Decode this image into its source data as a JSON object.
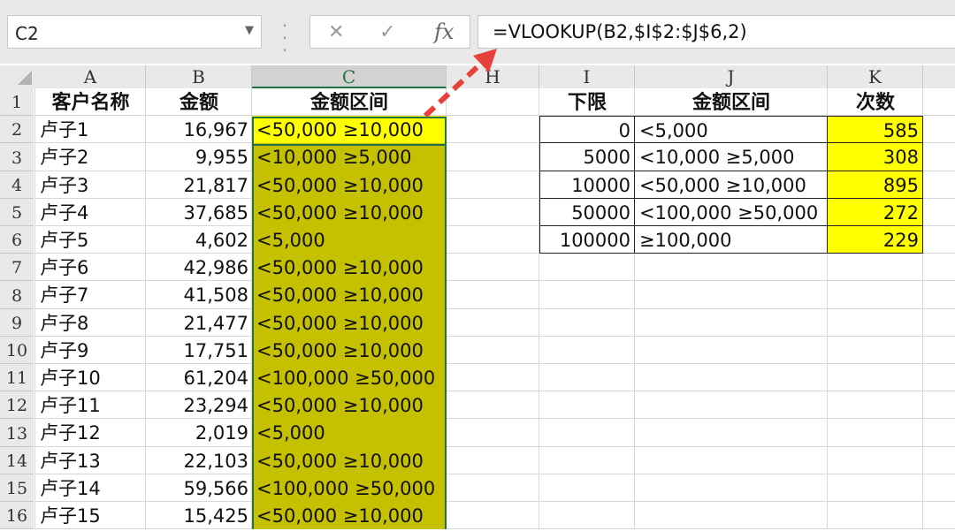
{
  "formula_bar": {
    "name_box": "C2",
    "cancel_icon": "✕",
    "enter_icon": "✓",
    "fx_label": "fx",
    "formula": "=VLOOKUP(B2,$I$2:$J$6,2)"
  },
  "columns": [
    "A",
    "B",
    "C",
    "H",
    "I",
    "J",
    "K"
  ],
  "rows": [
    "1",
    "2",
    "3",
    "4",
    "5",
    "6",
    "7",
    "8",
    "9",
    "10",
    "11",
    "12",
    "13",
    "14",
    "15",
    "16"
  ],
  "main_table": {
    "headers": [
      "客户名称",
      "金额",
      "金额区间"
    ],
    "rows": [
      {
        "name": "卢子1",
        "amount": "16,967",
        "range": "<50,000 ≥10,000"
      },
      {
        "name": "卢子2",
        "amount": "9,955",
        "range": "<10,000 ≥5,000"
      },
      {
        "name": "卢子3",
        "amount": "21,817",
        "range": "<50,000 ≥10,000"
      },
      {
        "name": "卢子4",
        "amount": "37,685",
        "range": "<50,000 ≥10,000"
      },
      {
        "name": "卢子5",
        "amount": "4,602",
        "range": "<5,000"
      },
      {
        "name": "卢子6",
        "amount": "42,986",
        "range": "<50,000 ≥10,000"
      },
      {
        "name": "卢子7",
        "amount": "41,508",
        "range": "<50,000 ≥10,000"
      },
      {
        "name": "卢子8",
        "amount": "21,477",
        "range": "<50,000 ≥10,000"
      },
      {
        "name": "卢子9",
        "amount": "17,751",
        "range": "<50,000 ≥10,000"
      },
      {
        "name": "卢子10",
        "amount": "61,204",
        "range": "<100,000 ≥50,000"
      },
      {
        "name": "卢子11",
        "amount": "23,294",
        "range": "<50,000 ≥10,000"
      },
      {
        "name": "卢子12",
        "amount": "2,019",
        "range": "<5,000"
      },
      {
        "name": "卢子13",
        "amount": "22,103",
        "range": "<50,000 ≥10,000"
      },
      {
        "name": "卢子14",
        "amount": "59,566",
        "range": "<100,000 ≥50,000"
      },
      {
        "name": "卢子15",
        "amount": "15,425",
        "range": "<50,000 ≥10,000"
      }
    ]
  },
  "lookup_table": {
    "headers": [
      "下限",
      "金额区间",
      "次数"
    ],
    "rows": [
      {
        "lower": "0",
        "range": "<5,000",
        "count": "585"
      },
      {
        "lower": "5000",
        "range": "<10,000 ≥5,000",
        "count": "308"
      },
      {
        "lower": "10000",
        "range": "<50,000 ≥10,000",
        "count": "895"
      },
      {
        "lower": "50000",
        "range": "<100,000 ≥50,000",
        "count": "272"
      },
      {
        "lower": "100000",
        "range": "≥100,000",
        "count": "229"
      }
    ]
  },
  "colors": {
    "selection_fill": "#c5c000",
    "active_cell_fill": "#ffff00",
    "count_fill": "#ffff00",
    "selection_border": "#217346",
    "arrow": "#e8413c"
  },
  "icons": {
    "name_box_dropdown": "chevron-down-icon",
    "cancel": "close-icon",
    "enter": "check-icon",
    "function": "fx-icon",
    "annotation": "dashed-arrow-icon"
  }
}
